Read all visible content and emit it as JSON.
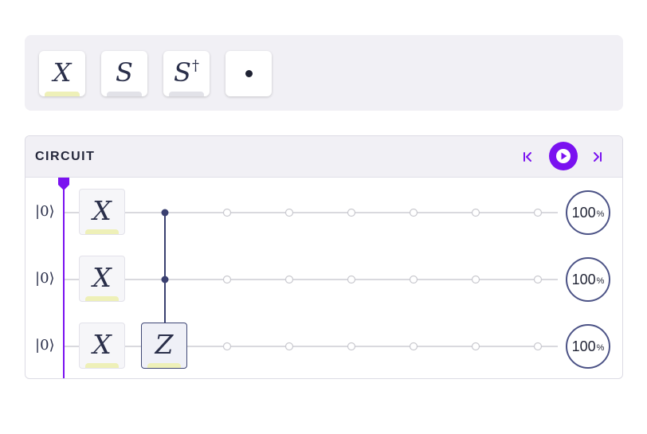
{
  "palette": {
    "tiles": [
      {
        "symbol": "X",
        "sup": "",
        "bar_color": "#eef0b8"
      },
      {
        "symbol": "S",
        "sup": "",
        "bar_color": "#e2e2e8"
      },
      {
        "symbol": "S",
        "sup": "†",
        "bar_color": "#e2e2e8"
      },
      {
        "symbol": "",
        "sup": "",
        "icon": "control-dot-icon"
      }
    ]
  },
  "circuit": {
    "title": "CIRCUIT",
    "controls": {
      "prev_icon": "step-back-icon",
      "play_icon": "play-icon",
      "next_icon": "step-forward-icon"
    },
    "qubits": [
      {
        "ket": "|0⟩",
        "gates": [
          {
            "symbol": "X"
          }
        ],
        "probability": "100",
        "unit": "%"
      },
      {
        "ket": "|0⟩",
        "gates": [
          {
            "symbol": "X"
          }
        ],
        "probability": "100",
        "unit": "%"
      },
      {
        "ket": "|0⟩",
        "gates": [
          {
            "symbol": "X"
          },
          {
            "symbol": "Z"
          }
        ],
        "probability": "100",
        "unit": "%"
      }
    ]
  },
  "colors": {
    "accent": "#7a12f0",
    "wire": "#d9d9de",
    "connector": "#3a4070",
    "gate_bar": "#eef0b8",
    "probability_ring": "#4c5386"
  }
}
